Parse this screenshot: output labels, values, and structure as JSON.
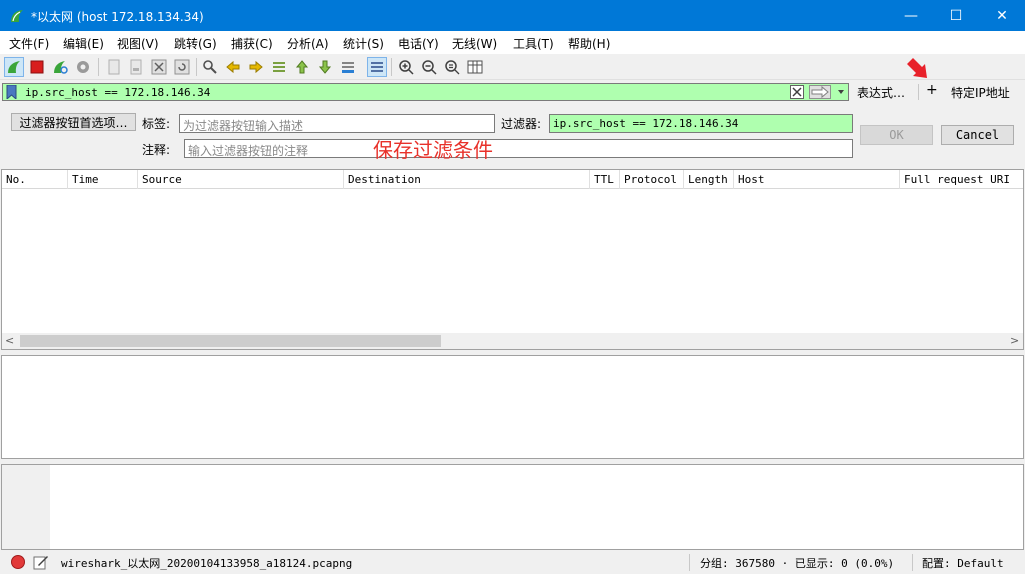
{
  "window": {
    "title": "*以太网 (host 172.18.134.34)",
    "minimize": "—",
    "maximize": "☐",
    "close": "✕"
  },
  "menu": [
    "文件(F)",
    "编辑(E)",
    "视图(V)",
    "跳转(G)",
    "捕获(C)",
    "分析(A)",
    "统计(S)",
    "电话(Y)",
    "无线(W)",
    "工具(T)",
    "帮助(H)"
  ],
  "filter_bar": {
    "value": "ip.src_host == 172.18.146.34",
    "expression_label": "表达式…",
    "add_label": "+",
    "preset_label": "特定IP地址"
  },
  "editor": {
    "pref_button": "过滤器按钮首选项…",
    "label_label": "标签:",
    "label_placeholder": "为过滤器按钮输入描述",
    "filter_label": "过滤器:",
    "filter_value": "ip.src_host == 172.18.146.34",
    "comment_label": "注释:",
    "comment_placeholder": "输入过滤器按钮的注释",
    "ok": "OK",
    "cancel": "Cancel"
  },
  "annotation": "保存过滤条件",
  "columns": [
    "No.",
    "Time",
    "Source",
    "Destination",
    "TTL",
    "Protocol",
    "Length",
    "Host",
    "Full request URI"
  ],
  "status": {
    "file": "wireshark_以太网_20200104133958_a18124.pcapng",
    "packets": "分组: 367580 · 已显示: 0 (0.0%)",
    "profile": "配置: Default"
  },
  "colors": {
    "titlebar": "#0078d7",
    "filter_valid": "#afffaf",
    "annotation": "#e8312a"
  }
}
